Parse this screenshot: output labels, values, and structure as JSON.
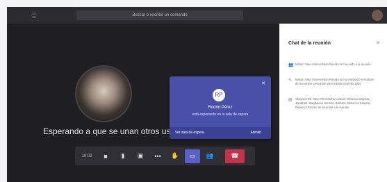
{
  "topbar": {
    "search_placeholder": "Buscar o escribir un comando"
  },
  "stage": {
    "waiting_text": "Esperando a que se unan otros usuarios..."
  },
  "controls": {
    "timer": "10:02"
  },
  "notification": {
    "initials": "RP",
    "name": "Rodrio Pérez",
    "message": "está esperando en la sala de espera",
    "admit_lobby_label": "Ver sala de espera",
    "admit_label": "Admitir"
  },
  "chat": {
    "title": "Chat de la reunión",
    "items": [
      {
        "icon": "people-icon",
        "glyph": "👥",
        "text": "Mason Yake Simeni Brian Rivcalo se ha unido a la reunión"
      },
      {
        "icon": "pencil-icon",
        "glyph": "✎",
        "text": "Mason Yake Simeni Brian Rivcalo se ha cambiado el nombre de la reunión a Reunión 2020-05/05 Chat RD 2020"
      },
      {
        "icon": "document-icon",
        "glyph": "▤",
        "text": "Shayana DE Yake Priti Rantha Laseatt, Rebecca Sarpeta, Jonathan, Magdalena Simons, Barbara, Rebecca Sarpeta, Rebecca Rivcalo se ha unido a la reunión"
      }
    ]
  }
}
